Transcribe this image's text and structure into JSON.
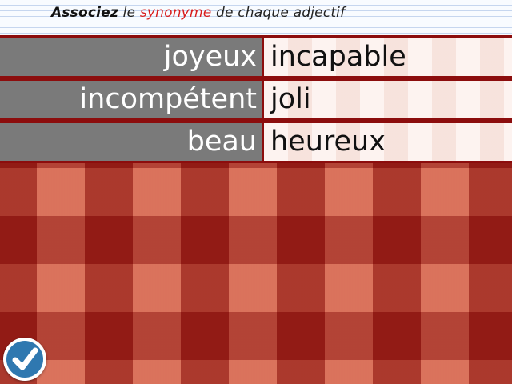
{
  "instruction": {
    "part1": "Associez",
    "part2": " le ",
    "part3": "synonyme",
    "part4": " de chaque adjectif"
  },
  "rows": [
    {
      "adjective": "joyeux",
      "synonym": "incapable"
    },
    {
      "adjective": "incompétent",
      "synonym": "joli"
    },
    {
      "adjective": "beau",
      "synonym": "heureux"
    }
  ],
  "check_button": {
    "icon": "check-icon"
  },
  "colors": {
    "accent": "#d81f1f",
    "adjective_cell": "#7a7a7a",
    "synonym_cell": "#fbe9e4",
    "check_button": "#2f78b0"
  }
}
